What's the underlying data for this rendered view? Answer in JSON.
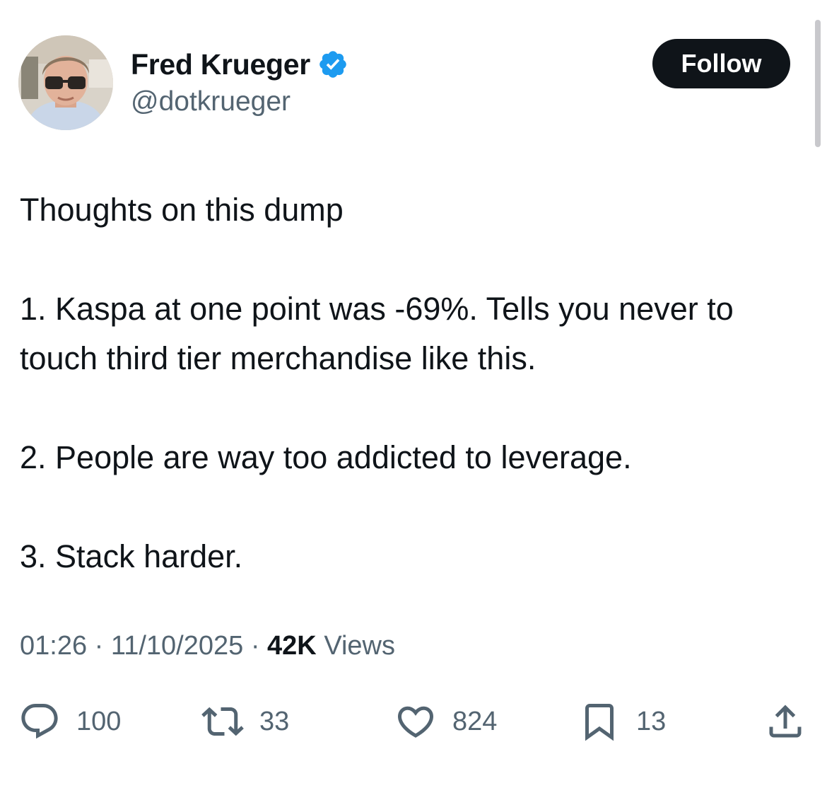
{
  "author": {
    "display_name": "Fred Krueger",
    "handle": "@dotkrueger",
    "verified": true
  },
  "follow_label": "Follow",
  "tweet": {
    "intro": "Thoughts on this dump",
    "point1": "1. Kaspa at one point was -69%. Tells you never to touch third tier merchandise like this.",
    "point2": "2. People are way too addicted to leverage.",
    "point3": "3. Stack harder."
  },
  "meta": {
    "time": "01:26",
    "separator": "·",
    "date": "11/10/2025",
    "views_count": "42K",
    "views_label": "Views"
  },
  "actions": {
    "replies": "100",
    "reposts": "33",
    "likes": "824",
    "bookmarks": "13"
  },
  "colors": {
    "text_primary": "#0f1419",
    "text_secondary": "#536471",
    "verified_blue": "#1d9bf0",
    "button_bg": "#0f1419"
  },
  "icons": [
    "verified-badge-icon",
    "reply-icon",
    "repost-icon",
    "like-icon",
    "bookmark-icon",
    "share-icon"
  ]
}
